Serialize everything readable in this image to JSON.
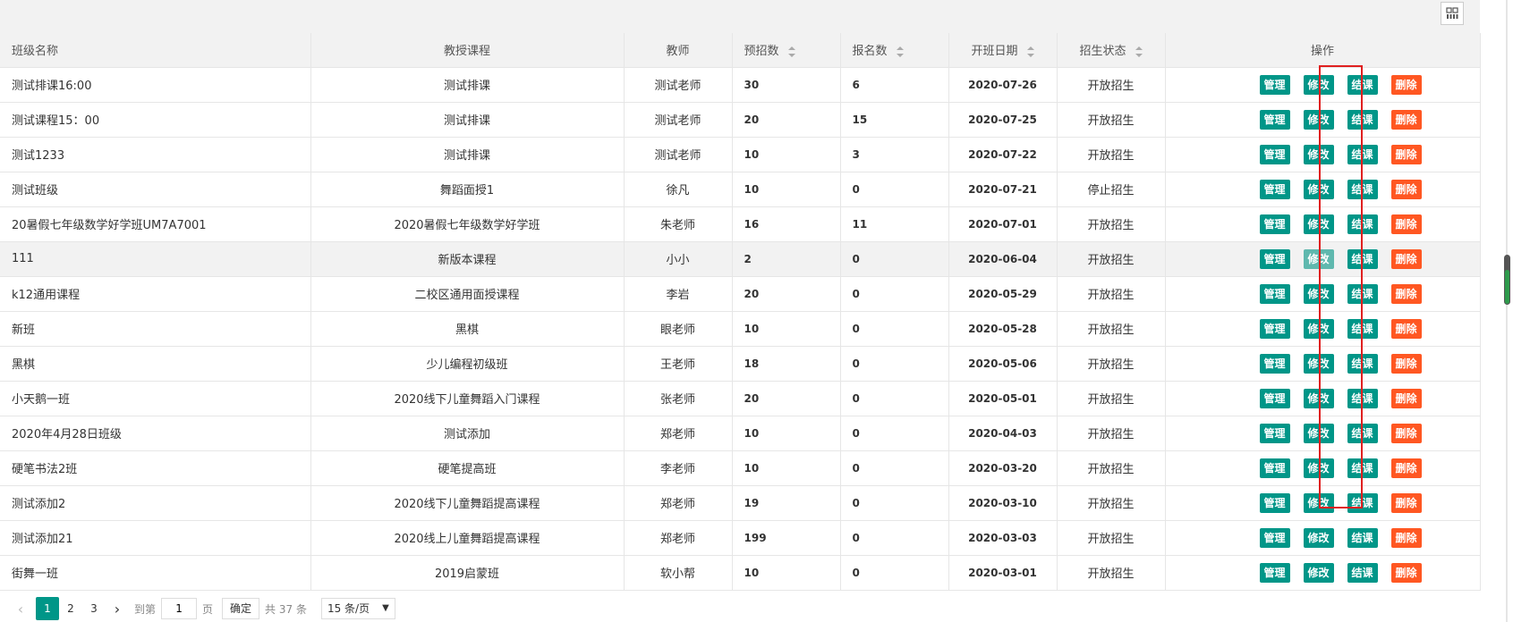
{
  "toolbar": {
    "columns_icon": "columns-grid-icon"
  },
  "table": {
    "headers": [
      "班级名称",
      "教授课程",
      "教师",
      "预招数",
      "报名数",
      "开班日期",
      "招生状态",
      "操作"
    ],
    "rows": [
      {
        "name": "测试排课16:00",
        "course": "测试排课",
        "teacher": "测试老师",
        "planned": "30",
        "enrolled": "6",
        "date": "2020-07-26",
        "status": "开放招生"
      },
      {
        "name": "测试课程15：00",
        "course": "测试排课",
        "teacher": "测试老师",
        "planned": "20",
        "enrolled": "15",
        "date": "2020-07-25",
        "status": "开放招生"
      },
      {
        "name": "测试1233",
        "course": "测试排课",
        "teacher": "测试老师",
        "planned": "10",
        "enrolled": "3",
        "date": "2020-07-22",
        "status": "开放招生"
      },
      {
        "name": "测试班级",
        "course": "舞蹈面授1",
        "teacher": "徐凡",
        "planned": "10",
        "enrolled": "0",
        "date": "2020-07-21",
        "status": "停止招生"
      },
      {
        "name": "20暑假七年级数学好学班UM7A7001",
        "course": "2020暑假七年级数学好学班",
        "teacher": "朱老师",
        "planned": "16",
        "enrolled": "11",
        "date": "2020-07-01",
        "status": "开放招生"
      },
      {
        "name": "111",
        "course": "新版本课程",
        "teacher": "小小",
        "planned": "2",
        "enrolled": "0",
        "date": "2020-06-04",
        "status": "开放招生"
      },
      {
        "name": "k12通用课程",
        "course": "二校区通用面授课程",
        "teacher": "李岩",
        "planned": "20",
        "enrolled": "0",
        "date": "2020-05-29",
        "status": "开放招生"
      },
      {
        "name": "新班",
        "course": "黑棋",
        "teacher": "眼老师",
        "planned": "10",
        "enrolled": "0",
        "date": "2020-05-28",
        "status": "开放招生"
      },
      {
        "name": "黑棋",
        "course": "少儿编程初级班",
        "teacher": "王老师",
        "planned": "18",
        "enrolled": "0",
        "date": "2020-05-06",
        "status": "开放招生"
      },
      {
        "name": "小天鹅一班",
        "course": "2020线下儿童舞蹈入门课程",
        "teacher": "张老师",
        "planned": "20",
        "enrolled": "0",
        "date": "2020-05-01",
        "status": "开放招生"
      },
      {
        "name": "2020年4月28日班级",
        "course": "测试添加",
        "teacher": "郑老师",
        "planned": "10",
        "enrolled": "0",
        "date": "2020-04-03",
        "status": "开放招生"
      },
      {
        "name": "硬笔书法2班",
        "course": "硬笔提高班",
        "teacher": "李老师",
        "planned": "10",
        "enrolled": "0",
        "date": "2020-03-20",
        "status": "开放招生"
      },
      {
        "name": "测试添加2",
        "course": "2020线下儿童舞蹈提高课程",
        "teacher": "郑老师",
        "planned": "19",
        "enrolled": "0",
        "date": "2020-03-10",
        "status": "开放招生"
      },
      {
        "name": "测试添加21",
        "course": "2020线上儿童舞蹈提高课程",
        "teacher": "郑老师",
        "planned": "199",
        "enrolled": "0",
        "date": "2020-03-03",
        "status": "开放招生"
      },
      {
        "name": "街舞一班",
        "course": "2019启蒙班",
        "teacher": "软小帮",
        "planned": "10",
        "enrolled": "0",
        "date": "2020-03-01",
        "status": "开放招生"
      }
    ],
    "actions": {
      "manage": "管理",
      "edit": "修改",
      "finish": "结课",
      "delete": "删除"
    }
  },
  "pagination": {
    "pages": [
      "1",
      "2",
      "3"
    ],
    "current": "1",
    "goto_label": "到第",
    "goto_value": "1",
    "page_unit": "页",
    "confirm_label": "确定",
    "total_label": "共 37 条",
    "page_size_label": "15 条/页"
  },
  "colors": {
    "teal": "#009688",
    "orange": "#ff5722",
    "highlight": "#e02020"
  }
}
